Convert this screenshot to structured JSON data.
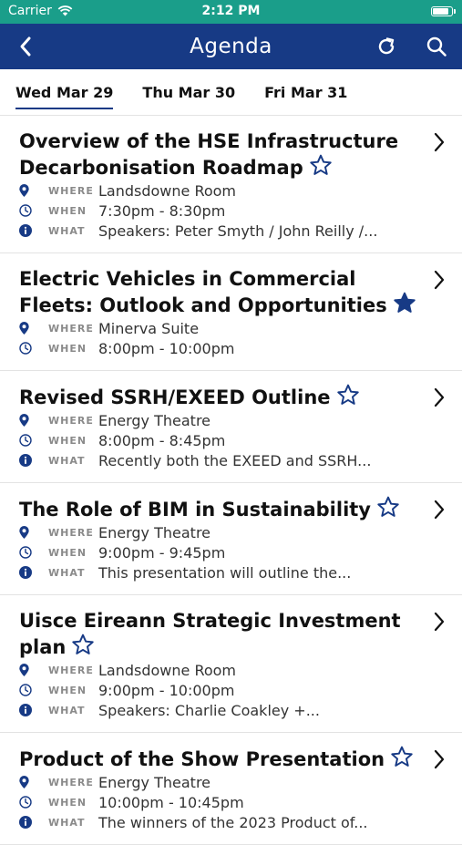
{
  "status": {
    "carrier": "Carrier",
    "time": "2:12 PM",
    "battery_level": 0.9
  },
  "nav": {
    "title": "Agenda",
    "back_icon": "chevron-left-icon",
    "refresh_icon": "refresh-icon",
    "search_icon": "search-icon"
  },
  "tabs": [
    {
      "label": "Wed Mar 29",
      "active": true
    },
    {
      "label": "Thu Mar 30",
      "active": false
    },
    {
      "label": "Fri Mar 31",
      "active": false
    }
  ],
  "labels": {
    "where": "WHERE",
    "when": "WHEN",
    "what": "WHAT"
  },
  "colors": {
    "status_bar": "#1a9e8a",
    "nav_bar": "#173a85",
    "accent": "#173a85"
  },
  "sessions": [
    {
      "title": "Overview of the HSE Infrastructure Decarbonisation Roadmap",
      "starred": false,
      "where": "Landsdowne Room",
      "when": "7:30pm - 8:30pm",
      "what": "Speakers: Peter Smyth / John Reilly /..."
    },
    {
      "title": "Electric Vehicles in Commercial Fleets: Outlook and Opportunities",
      "starred": true,
      "where": "Minerva Suite",
      "when": "8:00pm - 10:00pm"
    },
    {
      "title": "Revised SSRH/EXEED Outline",
      "starred": false,
      "where": "Energy Theatre",
      "when": "8:00pm - 8:45pm",
      "what": "Recently both the EXEED and SSRH..."
    },
    {
      "title": "The Role of BIM in Sustainability",
      "starred": false,
      "where": "Energy Theatre",
      "when": "9:00pm - 9:45pm",
      "what": "This presentation will outline the..."
    },
    {
      "title": "Uisce Eireann Strategic Investment plan",
      "starred": false,
      "where": "Landsdowne Room",
      "when": "9:00pm - 10:00pm",
      "what": "Speakers: Charlie Coakley +..."
    },
    {
      "title": "Product of the Show Presentation",
      "starred": false,
      "where": "Energy Theatre",
      "when": "10:00pm - 10:45pm",
      "what": "The winners of the 2023 Product of..."
    }
  ]
}
